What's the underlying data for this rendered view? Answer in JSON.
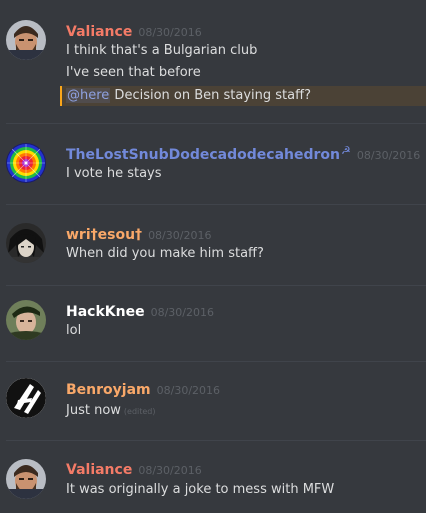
{
  "messages": [
    {
      "username": "Valiance",
      "username_color": "#f47b67",
      "timestamp": "08/30/2016",
      "avatar": "bearded-man-icon",
      "lines": [
        "I think that's a Bulgarian club",
        "I've seen that before"
      ],
      "mention": {
        "tag": "@here",
        "text": " Decision on Ben staying staff?"
      }
    },
    {
      "username": "TheLostSnubDodecadodecahedron",
      "username_color": "#7289da",
      "badge_icon": "hammer-sickle-icon",
      "timestamp": "08/30/2016",
      "avatar": "rainbow-mandala-icon",
      "lines": [
        "I vote he stays"
      ]
    },
    {
      "username": "wri†esou†",
      "username_color": "#f9a869",
      "timestamp": "08/30/2016",
      "avatar": "anime-character-icon",
      "lines": [
        "When did you make him staff?"
      ]
    },
    {
      "username": "HackKnee",
      "username_color": "#ffffff",
      "timestamp": "08/30/2016",
      "avatar": "soldier-icon",
      "lines": [
        "lol"
      ]
    },
    {
      "username": "Benroyjam",
      "username_color": "#f9a869",
      "timestamp": "08/30/2016",
      "avatar": "slash-logo-icon",
      "lines": [
        "Just now"
      ],
      "edited": "(edited)"
    },
    {
      "username": "Valiance",
      "username_color": "#f47b67",
      "timestamp": "08/30/2016",
      "avatar": "bearded-man-icon",
      "lines": [
        "It was originally a joke to mess with MFW"
      ]
    }
  ]
}
